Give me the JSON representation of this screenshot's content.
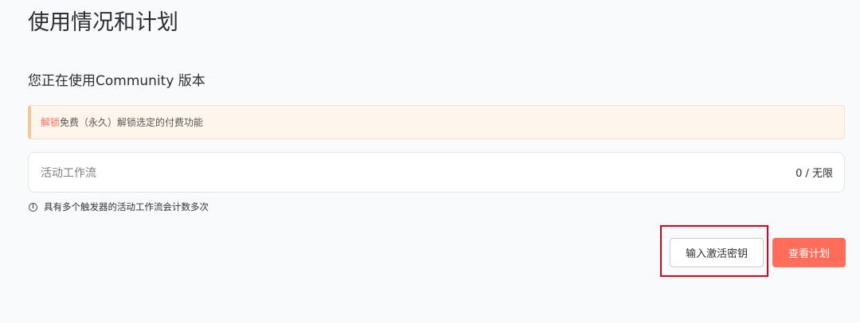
{
  "page": {
    "title": "使用情况和计划",
    "plan_heading": "您正在使用Community 版本"
  },
  "notice": {
    "link_text": "解锁",
    "text": "免费（永久）解锁选定的付费功能"
  },
  "usage": {
    "label": "活动工作流",
    "value": "0 / 无限"
  },
  "info": {
    "icon": "info-circle-icon",
    "text": "具有多个触发器的活动工作流会计数多次"
  },
  "actions": {
    "enter_key_label": "输入激活密钥",
    "view_plans_label": "查看计划"
  },
  "colors": {
    "accent": "#ff6d5a",
    "highlight": "#e0001b",
    "notice_bg": "#fef6ec"
  }
}
